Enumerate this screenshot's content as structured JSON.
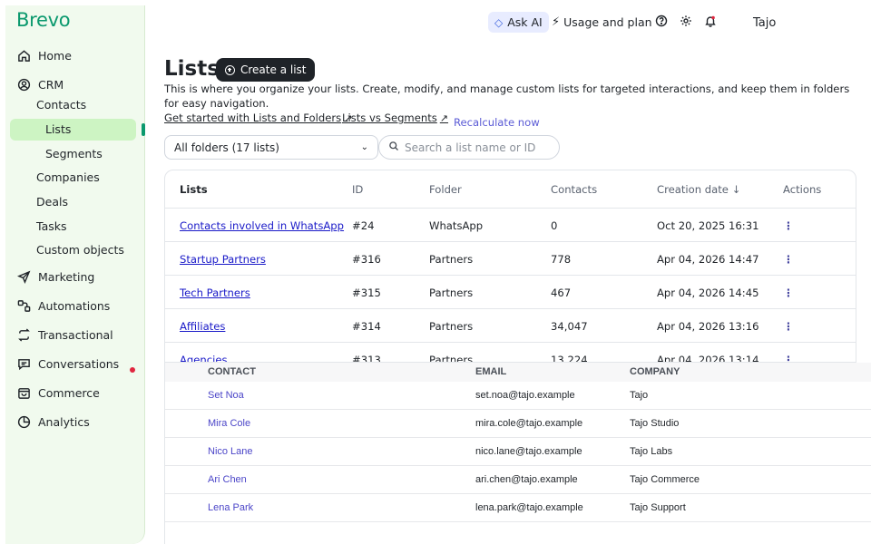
{
  "brand": {
    "name": "Brevo",
    "color": "#0b996e"
  },
  "sidebar": {
    "items": [
      {
        "label": "Home",
        "icon": "home-icon"
      },
      {
        "label": "CRM",
        "icon": "user-circle-icon"
      },
      {
        "label": "Marketing",
        "icon": "send-icon"
      },
      {
        "label": "Automations",
        "icon": "automation-icon"
      },
      {
        "label": "Transactional",
        "icon": "repeat-icon"
      },
      {
        "label": "Conversations",
        "icon": "chat-icon"
      },
      {
        "label": "Commerce",
        "icon": "shopping-bag-icon"
      },
      {
        "label": "Analytics",
        "icon": "pie-chart-icon"
      }
    ],
    "crm_sub": [
      "Contacts",
      "Lists",
      "Segments",
      "Companies",
      "Deals",
      "Tasks",
      "Custom objects"
    ],
    "active": "Lists",
    "notification_color": "#e0263f"
  },
  "header": {
    "ask_ai": "Ask AI",
    "usage": "Usage and plan",
    "user": "Tajo"
  },
  "page": {
    "title": "Lists",
    "create_button": "Create a list",
    "description": "This is where you organize your lists. Create, modify, and manage custom lists for targeted interactions, and keep them in folders for easy navigation.",
    "link_get_started": "Get started with Lists and Folders",
    "link_vs_segments": "Lists vs Segments",
    "recalculate": "Recalculate now",
    "folder_filter": "All folders (17 lists)",
    "search_placeholder": "Search a list name or ID"
  },
  "table": {
    "columns": [
      "Lists",
      "ID",
      "Folder",
      "Contacts",
      "Creation date",
      "Actions"
    ],
    "rows": [
      {
        "name": "Contacts involved in WhatsApp",
        "id": "#24",
        "folder": "WhatsApp",
        "contacts": "0",
        "date": "Oct 20, 2025 16:31"
      },
      {
        "name": "Startup Partners",
        "id": "#316",
        "folder": "Partners",
        "contacts": "778",
        "date": "Apr 04, 2026 14:47"
      },
      {
        "name": "Tech Partners",
        "id": "#315",
        "folder": "Partners",
        "contacts": "467",
        "date": "Apr 04, 2026 14:45"
      },
      {
        "name": "Affiliates",
        "id": "#314",
        "folder": "Partners",
        "contacts": "34,047",
        "date": "Apr 04, 2026 13:16"
      },
      {
        "name": "Agencies",
        "id": "#313",
        "folder": "Partners",
        "contacts": "13,224",
        "date": "Apr 04, 2026 13:14"
      }
    ]
  },
  "contacts_panel": {
    "columns": [
      "CONTACT",
      "EMAIL",
      "COMPANY"
    ],
    "rows": [
      {
        "contact": "Set Noa",
        "email": "set.noa@tajo.example",
        "company": "Tajo"
      },
      {
        "contact": "Mira Cole",
        "email": "mira.cole@tajo.example",
        "company": "Tajo Studio"
      },
      {
        "contact": "Nico Lane",
        "email": "nico.lane@tajo.example",
        "company": "Tajo Labs"
      },
      {
        "contact": "Ari Chen",
        "email": "ari.chen@tajo.example",
        "company": "Tajo Commerce"
      },
      {
        "contact": "Lena Park",
        "email": "lena.park@tajo.example",
        "company": "Tajo Support"
      }
    ]
  }
}
